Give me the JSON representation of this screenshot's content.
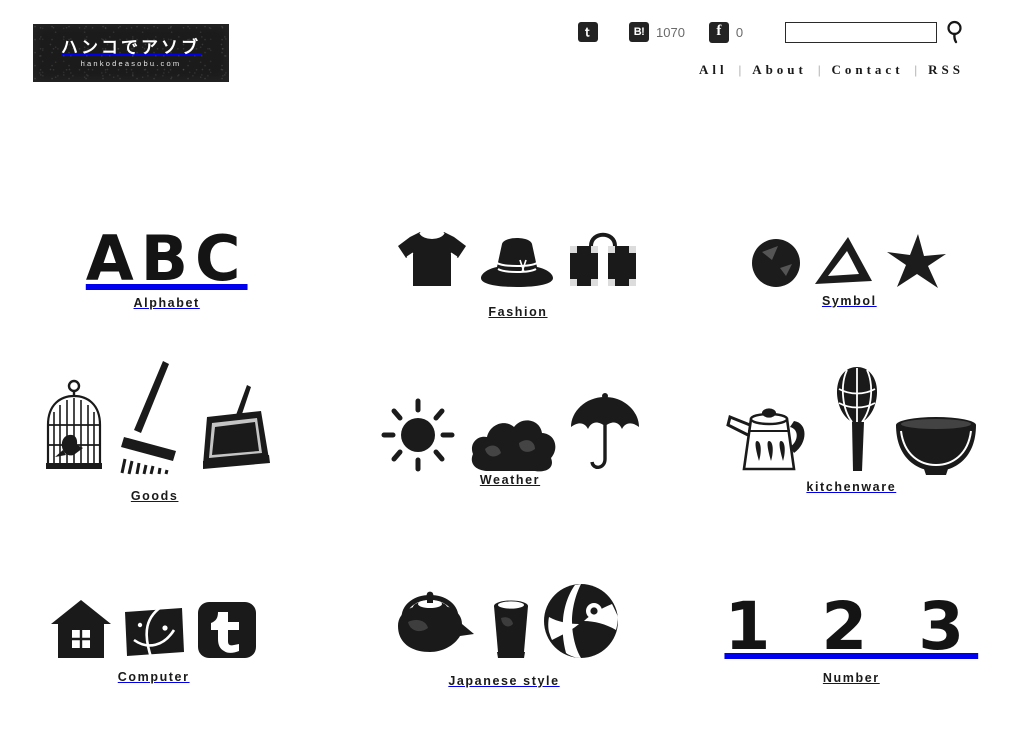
{
  "site": {
    "logo_jp": "ハンコでアソブ",
    "logo_domain": "hankodeasobu.com",
    "brand_color": "#1b1b1b",
    "background_color": "#ffffff"
  },
  "header": {
    "social": [
      {
        "icon": "twitter-icon",
        "glyph": "t",
        "count": ""
      },
      {
        "icon": "hatena-bookmark-icon",
        "glyph": "B!",
        "count": "1070"
      },
      {
        "icon": "facebook-icon",
        "glyph": "f",
        "count": "0"
      }
    ],
    "search": {
      "value": "",
      "placeholder": "",
      "button_icon": "search-icon"
    },
    "nav": [
      {
        "label": "All"
      },
      {
        "label": "About"
      },
      {
        "label": "Contact"
      },
      {
        "label": "RSS"
      }
    ],
    "nav_separator": "|"
  },
  "categories": [
    {
      "label": "Alphabet",
      "art": "abc-stamps",
      "text": "ABC"
    },
    {
      "label": "Fashion",
      "art": "tshirt-hat-suitcase-stamps"
    },
    {
      "label": "Symbol",
      "art": "circle-triangle-star-stamps"
    },
    {
      "label": "Goods",
      "art": "birdcage-broom-dustpan-stamps"
    },
    {
      "label": "Weather",
      "art": "sun-cloud-umbrella-stamps"
    },
    {
      "label": "kitchenware",
      "art": "kettle-whisk-bowl-stamps"
    },
    {
      "label": "Computer",
      "art": "house-browser-twitter-stamps"
    },
    {
      "label": "Japanese style",
      "art": "teapot-cup-temari-stamps"
    },
    {
      "label": "Number",
      "art": "123-stamps",
      "text": "1 2 3"
    }
  ]
}
